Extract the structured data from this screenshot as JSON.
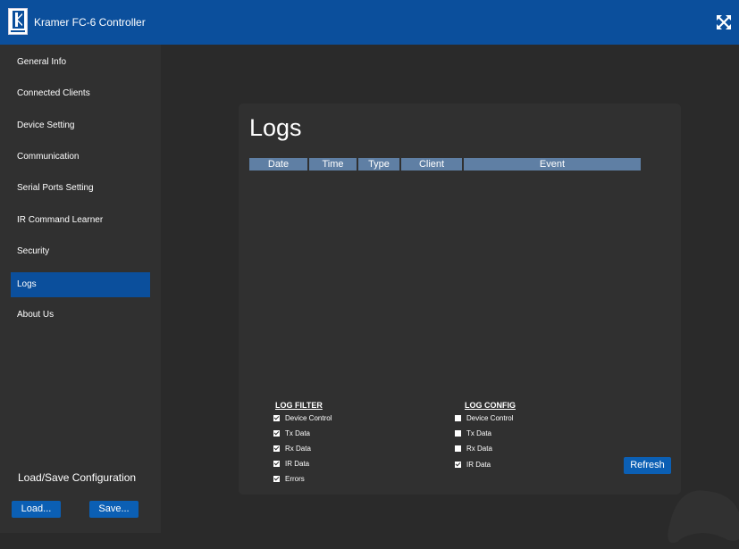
{
  "header": {
    "title": "Kramer FC-6 Controller",
    "logo_icon": "kramer-logo-icon",
    "expand_icon": "expand-arrows-icon"
  },
  "sidebar": {
    "items": [
      {
        "label": "General Info",
        "active": false
      },
      {
        "label": "Connected Clients",
        "active": false
      },
      {
        "label": "Device Setting",
        "active": false
      },
      {
        "label": "Communication",
        "active": false
      },
      {
        "label": "Serial Ports Setting",
        "active": false
      },
      {
        "label": "IR Command Learner",
        "active": false
      },
      {
        "label": "Security",
        "active": false
      },
      {
        "label": "Logs",
        "active": true
      },
      {
        "label": "About Us",
        "active": false
      }
    ],
    "load_save_title": "Load/Save Configuration",
    "load_label": "Load...",
    "save_label": "Save..."
  },
  "logs": {
    "title": "Logs",
    "columns": [
      "Date",
      "Time",
      "Type",
      "Client",
      "Event"
    ],
    "rows": [],
    "log_filter": {
      "title": "LOG FILTER",
      "items": [
        {
          "label": "Device Control",
          "checked": true
        },
        {
          "label": "Tx Data",
          "checked": true
        },
        {
          "label": "Rx Data",
          "checked": true
        },
        {
          "label": "IR Data",
          "checked": true
        },
        {
          "label": "Errors",
          "checked": true
        }
      ]
    },
    "log_config": {
      "title": "LOG CONFIG",
      "items": [
        {
          "label": "Device Control",
          "checked": false
        },
        {
          "label": "Tx Data",
          "checked": false
        },
        {
          "label": "Rx Data",
          "checked": false
        },
        {
          "label": "IR Data",
          "checked": true
        }
      ]
    },
    "refresh_label": "Refresh"
  },
  "colors": {
    "header": "#0b4f9c",
    "active": "#0b4f9c",
    "background": "#2a2a2a",
    "sidebar": "#303030",
    "table_header": "#5f7fa4"
  }
}
